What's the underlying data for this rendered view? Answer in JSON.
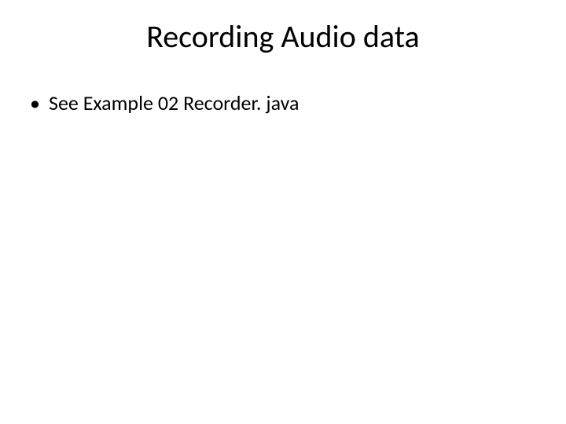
{
  "slide": {
    "title": "Recording Audio data",
    "bullets": [
      "See Example 02 Recorder. java"
    ]
  }
}
